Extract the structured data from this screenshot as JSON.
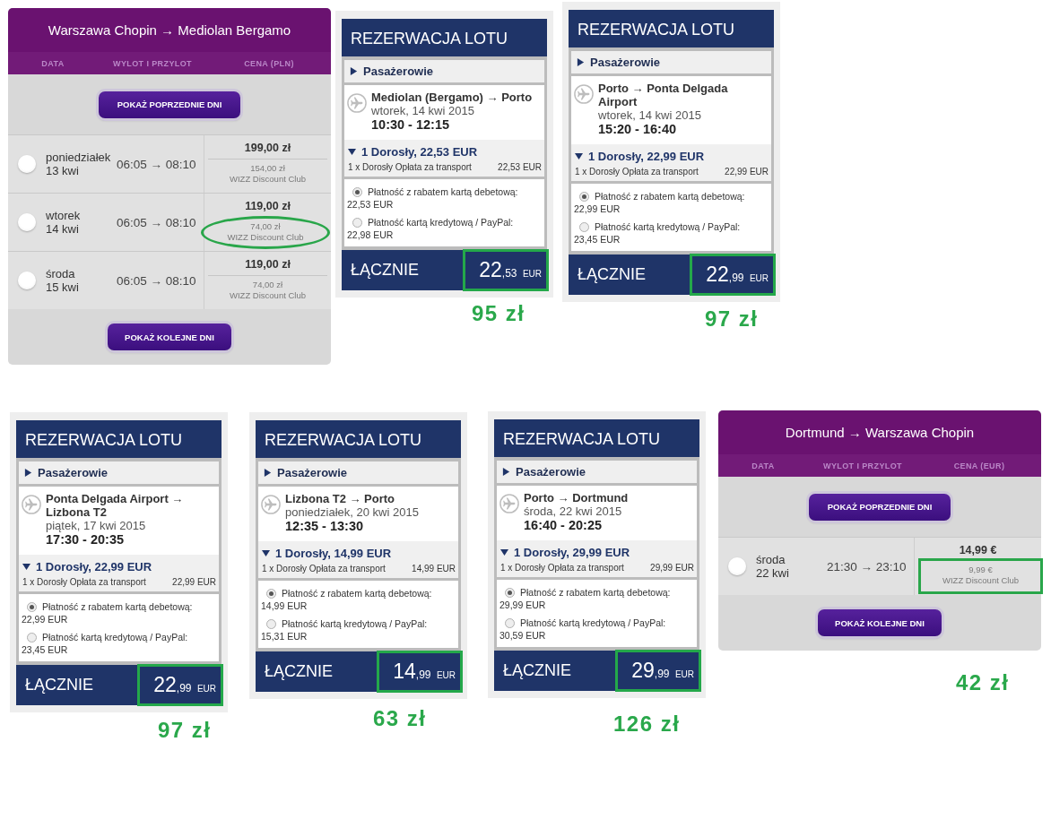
{
  "panels": [
    {
      "kind": "calendar",
      "title": "Warszawa Chopin → Mediolan Bergamo",
      "columns": [
        "DATA",
        "WYLOT I PRZYLOT",
        "CENA (PLN)"
      ],
      "previous_button": "POKAŻ POPRZEDNIE DNI",
      "next_button": "POKAŻ KOLEJNE DNI",
      "days": [
        {
          "weekday": "poniedziałek",
          "date": "13 kwi",
          "times": "06:05 → 08:10",
          "price": "199,00 zł",
          "club_price": "154,00 zł",
          "club_label": "WIZZ Discount Club",
          "selected": false,
          "circled": false
        },
        {
          "weekday": "wtorek",
          "date": "14 kwi",
          "times": "06:05 → 08:10",
          "price": "119,00 zł",
          "club_price": "74,00 zł",
          "club_label": "WIZZ Discount Club",
          "selected": false,
          "circled": true
        },
        {
          "weekday": "środa",
          "date": "15 kwi",
          "times": "06:05 → 08:10",
          "price": "119,00 zł",
          "club_price": "74,00 zł",
          "club_label": "WIZZ Discount Club",
          "selected": false,
          "circled": false
        }
      ]
    },
    {
      "kind": "booking",
      "title": "REZERWACJA LOTU",
      "passengers": {
        "label": "Pasażerowie",
        "expanded": false
      },
      "route": "Mediolan (Bergamo) → Porto",
      "date": "wtorek, 14 kwi 2015",
      "times": "10:30 - 12:15",
      "fare": {
        "summary": "1 Dorosły, 22,53 EUR",
        "expanded": true,
        "line_label": "1 x Dorosły Opłata za transport",
        "line_amount": "22,53 EUR"
      },
      "payments": [
        {
          "label": "Płatność z rabatem kartą debetową:",
          "amount": "22,53 EUR",
          "selected": true
        },
        {
          "label": "Płatność kartą kredytową / PayPal:",
          "amount": "22,98 EUR",
          "selected": false
        }
      ],
      "total_label": "ŁĄCZNIE",
      "total": {
        "whole": "22",
        "fraction": ",53",
        "currency": "EUR",
        "highlighted": true
      },
      "annotation": "95 zł"
    },
    {
      "kind": "booking",
      "title": "REZERWACJA LOTU",
      "passengers": {
        "label": "Pasażerowie",
        "expanded": false
      },
      "route": "Porto → Ponta Delgada Airport",
      "date": "wtorek, 14 kwi 2015",
      "times": "15:20 - 16:40",
      "fare": {
        "summary": "1 Dorosły, 22,99 EUR",
        "expanded": true,
        "line_label": "1 x Dorosły Opłata za transport",
        "line_amount": "22,99 EUR"
      },
      "payments": [
        {
          "label": "Płatność z rabatem kartą debetową:",
          "amount": "22,99 EUR",
          "selected": true
        },
        {
          "label": "Płatność kartą kredytową / PayPal:",
          "amount": "23,45 EUR",
          "selected": false
        }
      ],
      "total_label": "ŁĄCZNIE",
      "total": {
        "whole": "22",
        "fraction": ",99",
        "currency": "EUR",
        "highlighted": true
      },
      "annotation": "97 zł"
    },
    {
      "kind": "booking",
      "title": "REZERWACJA LOTU",
      "passengers": {
        "label": "Pasażerowie",
        "expanded": false
      },
      "route": "Ponta Delgada Airport → Lizbona T2",
      "date": "piątek, 17 kwi 2015",
      "times": "17:30 - 20:35",
      "fare": {
        "summary": "1 Dorosły, 22,99 EUR",
        "expanded": true,
        "line_label": "1 x Dorosły Opłata za transport",
        "line_amount": "22,99 EUR"
      },
      "payments": [
        {
          "label": "Płatność z rabatem kartą debetową:",
          "amount": "22,99 EUR",
          "selected": true
        },
        {
          "label": "Płatność kartą kredytową / PayPal:",
          "amount": "23,45 EUR",
          "selected": false
        }
      ],
      "total_label": "ŁĄCZNIE",
      "total": {
        "whole": "22",
        "fraction": ",99",
        "currency": "EUR",
        "highlighted": true
      },
      "annotation": "97 zł"
    },
    {
      "kind": "booking",
      "title": "REZERWACJA LOTU",
      "passengers": {
        "label": "Pasażerowie",
        "expanded": false
      },
      "route": "Lizbona T2 → Porto",
      "date": "poniedziałek, 20 kwi 2015",
      "times": "12:35 - 13:30",
      "fare": {
        "summary": "1 Dorosły, 14,99 EUR",
        "expanded": true,
        "line_label": "1 x Dorosły Opłata za transport",
        "line_amount": "14,99 EUR"
      },
      "payments": [
        {
          "label": "Płatność z rabatem kartą debetową:",
          "amount": "14,99 EUR",
          "selected": true
        },
        {
          "label": "Płatność kartą kredytową / PayPal:",
          "amount": "15,31 EUR",
          "selected": false
        }
      ],
      "total_label": "ŁĄCZNIE",
      "total": {
        "whole": "14",
        "fraction": ",99",
        "currency": "EUR",
        "highlighted": true
      },
      "annotation": "63 zł"
    },
    {
      "kind": "booking",
      "title": "REZERWACJA LOTU",
      "passengers": {
        "label": "Pasażerowie",
        "expanded": false
      },
      "route": "Porto → Dortmund",
      "date": "środa, 22 kwi 2015",
      "times": "16:40 - 20:25",
      "fare": {
        "summary": "1 Dorosły, 29,99 EUR",
        "expanded": true,
        "line_label": "1 x Dorosły Opłata za transport",
        "line_amount": "29,99 EUR"
      },
      "payments": [
        {
          "label": "Płatność z rabatem kartą debetową:",
          "amount": "29,99 EUR",
          "selected": true
        },
        {
          "label": "Płatność kartą kredytową / PayPal:",
          "amount": "30,59 EUR",
          "selected": false
        }
      ],
      "total_label": "ŁĄCZNIE",
      "total": {
        "whole": "29",
        "fraction": ",99",
        "currency": "EUR",
        "highlighted": true
      },
      "annotation": "126 zł"
    },
    {
      "kind": "calendar",
      "title": "Dortmund → Warszawa Chopin",
      "columns": [
        "DATA",
        "WYLOT I PRZYLOT",
        "CENA (EUR)"
      ],
      "previous_button": "POKAŻ POPRZEDNIE DNI",
      "next_button": "POKAŻ KOLEJNE DNI",
      "days": [
        {
          "weekday": "środa",
          "date": "22 kwi",
          "times": "21:30 → 23:10",
          "price": "14,99 €",
          "club_price": "9,99 €",
          "club_label": "WIZZ Discount Club",
          "selected": false,
          "framed": true
        }
      ],
      "annotation": "42 zł"
    }
  ]
}
